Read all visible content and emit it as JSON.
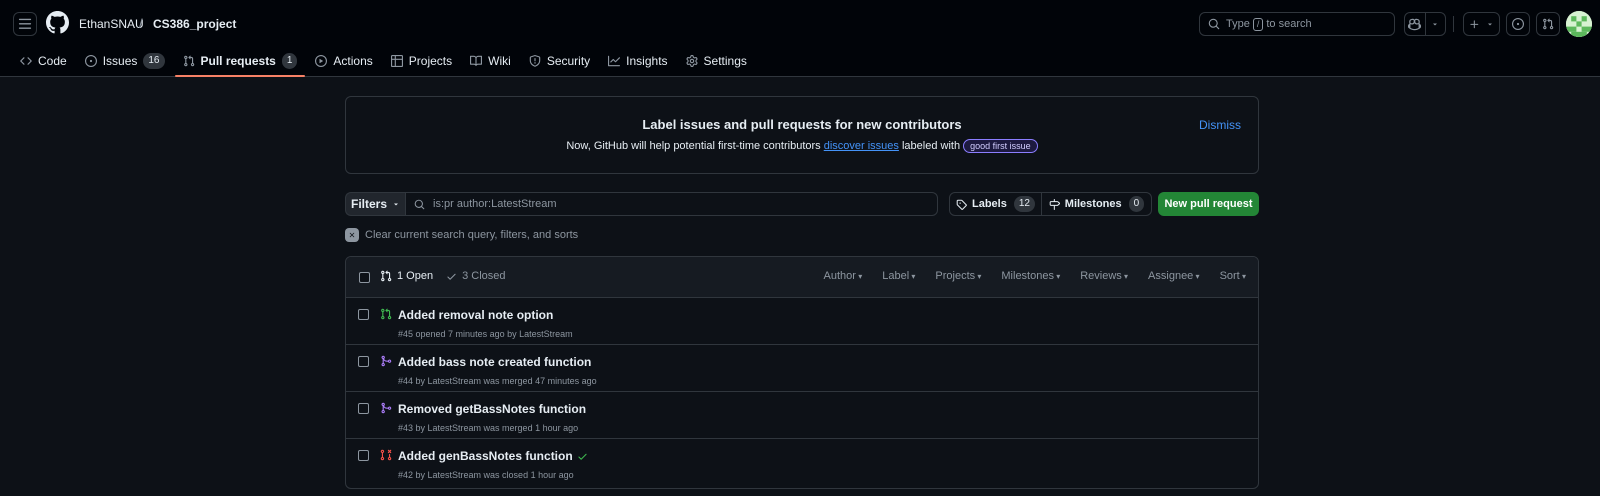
{
  "header": {
    "owner": "EthanSNAU",
    "separator": "/",
    "repo": "CS386_project",
    "search_prefix": "Type",
    "search_key": "/",
    "search_suffix": "to search"
  },
  "nav": {
    "tabs": [
      {
        "label": "Code",
        "icon": "code-icon"
      },
      {
        "label": "Issues",
        "icon": "issue-opened-icon",
        "count": "16"
      },
      {
        "label": "Pull requests",
        "icon": "git-pull-request-icon",
        "count": "1",
        "selected": true
      },
      {
        "label": "Actions",
        "icon": "play-icon"
      },
      {
        "label": "Projects",
        "icon": "table-icon"
      },
      {
        "label": "Wiki",
        "icon": "book-icon"
      },
      {
        "label": "Security",
        "icon": "shield-icon"
      },
      {
        "label": "Insights",
        "icon": "graph-icon"
      },
      {
        "label": "Settings",
        "icon": "gear-icon"
      }
    ]
  },
  "banner": {
    "title": "Label issues and pull requests for new contributors",
    "text_before": "Now, GitHub will help potential first-time contributors",
    "link": "discover issues",
    "text_after": "labeled with",
    "label": "good first issue",
    "dismiss": "Dismiss"
  },
  "filters": {
    "button": "Filters",
    "query": "is:pr author:LatestStream",
    "labels": "Labels",
    "labels_count": "12",
    "milestones": "Milestones",
    "milestones_count": "0",
    "new_pr": "New pull request",
    "clear": "Clear current search query, filters, and sorts"
  },
  "list": {
    "open": "1 Open",
    "closed": "3 Closed",
    "menus": [
      "Author",
      "Label",
      "Projects",
      "Milestones",
      "Reviews",
      "Assignee",
      "Sort"
    ],
    "rows": [
      {
        "title": "Added removal note option",
        "meta": "#45 opened 7 minutes ago by LatestStream",
        "state": "open"
      },
      {
        "title": "Added bass note created function",
        "meta": "#44 by LatestStream was merged 47 minutes ago",
        "state": "merged"
      },
      {
        "title": "Removed getBassNotes function",
        "meta": "#43 by LatestStream was merged 1 hour ago",
        "state": "merged"
      },
      {
        "title": "Added genBassNotes function",
        "meta": "#42 by LatestStream was closed 1 hour ago",
        "state": "closed",
        "check": true
      }
    ]
  },
  "colors": {
    "open": "#3fb950",
    "merged": "#ab7df8",
    "closed": "#f85149",
    "accent": "#f78166",
    "link": "#4493f8",
    "button_green": "#238636"
  }
}
